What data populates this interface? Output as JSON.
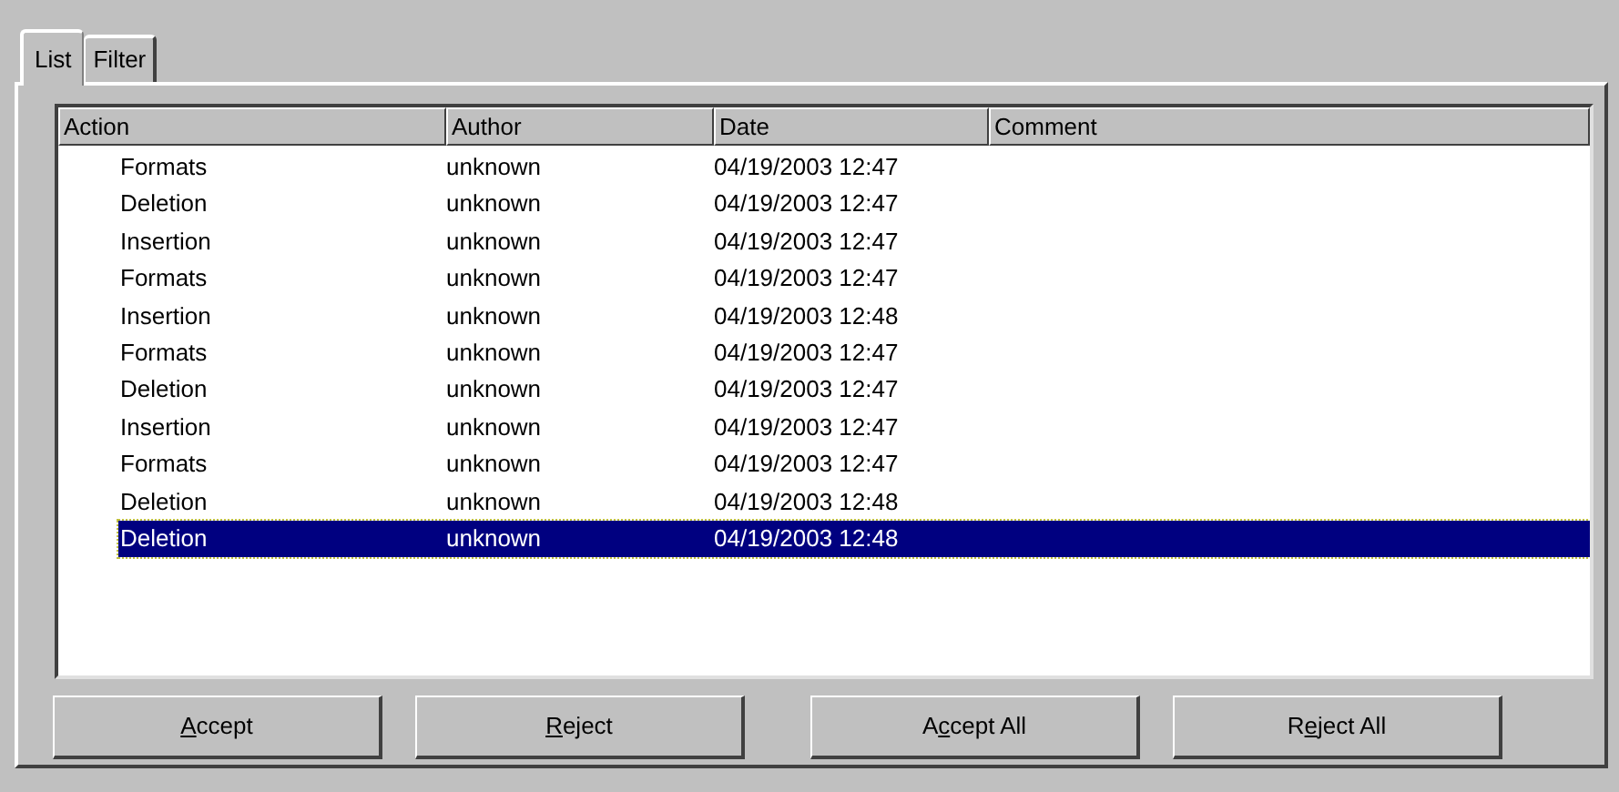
{
  "tabs": [
    {
      "label": "List",
      "selected": true
    },
    {
      "label": "Filter",
      "selected": false
    }
  ],
  "table": {
    "columns": [
      "Action",
      "Author",
      "Date",
      "Comment"
    ],
    "rows": [
      {
        "action": "Formats",
        "author": "unknown",
        "date": "04/19/2003 12:47",
        "selected": false
      },
      {
        "action": "Deletion",
        "author": "unknown",
        "date": "04/19/2003 12:47",
        "selected": false
      },
      {
        "action": "Insertion",
        "author": "unknown",
        "date": "04/19/2003 12:47",
        "selected": false
      },
      {
        "action": "Formats",
        "author": "unknown",
        "date": "04/19/2003 12:47",
        "selected": false
      },
      {
        "action": "Insertion",
        "author": "unknown",
        "date": "04/19/2003 12:48",
        "selected": false
      },
      {
        "action": "Formats",
        "author": "unknown",
        "date": "04/19/2003 12:47",
        "selected": false
      },
      {
        "action": "Deletion",
        "author": "unknown",
        "date": "04/19/2003 12:47",
        "selected": false
      },
      {
        "action": "Insertion",
        "author": "unknown",
        "date": "04/19/2003 12:47",
        "selected": false
      },
      {
        "action": "Formats",
        "author": "unknown",
        "date": "04/19/2003 12:47",
        "selected": false
      },
      {
        "action": "Deletion",
        "author": "unknown",
        "date": "04/19/2003 12:48",
        "selected": false
      },
      {
        "action": "Deletion",
        "author": "unknown",
        "date": "04/19/2003 12:48",
        "selected": true
      }
    ]
  },
  "buttons": [
    {
      "key": "A",
      "after": "ccept"
    },
    {
      "key": "R",
      "after": "eject"
    },
    {
      "before": "A",
      "key": "c",
      "after": "cept All"
    },
    {
      "before": "R",
      "key": "e",
      "after": "ject All"
    }
  ]
}
